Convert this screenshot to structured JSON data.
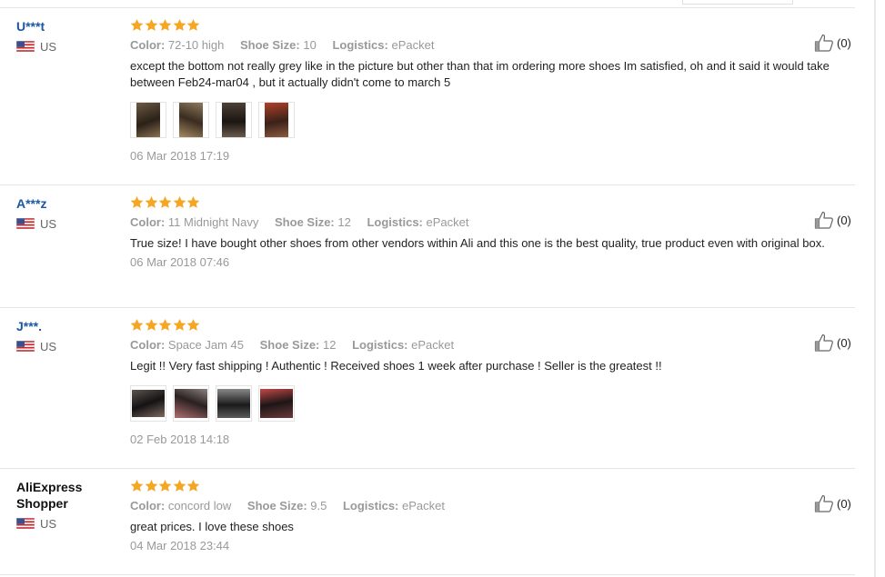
{
  "labels": {
    "color": "Color:",
    "shoe_size": "Shoe Size:",
    "logistics": "Logistics:"
  },
  "reviews": [
    {
      "user": "U***t",
      "country": "US",
      "rating": 5,
      "color": "72-10 high",
      "shoe_size": "10",
      "logistics": "ePacket",
      "text": "except the bottom not really grey like in the picture but other than that im ordering more shoes Im satisfied, oh and it said it would take between Feb24-mar04 , but it actually didn't come to march 5",
      "photo_count": 4,
      "date": "06 Mar 2018 17:19",
      "likes": "(0)"
    },
    {
      "user": "A***z",
      "country": "US",
      "rating": 5,
      "color": "11 Midnight Navy",
      "shoe_size": "12",
      "logistics": "ePacket",
      "text": "True size! I have bought other shoes from other vendors within Ali and this one is the best quality, true product even with original box.",
      "photo_count": 0,
      "date": "06 Mar 2018 07:46",
      "likes": "(0)"
    },
    {
      "user": "J***.",
      "country": "US",
      "rating": 5,
      "color": "Space Jam 45",
      "shoe_size": "12",
      "logistics": "ePacket",
      "text": "Legit !! Very fast shipping ! Authentic ! Received shoes 1 week after purchase ! Seller is the greatest !!",
      "photo_count": 4,
      "date": "02 Feb 2018 14:18",
      "likes": "(0)"
    },
    {
      "user": "AliExpress Shopper",
      "country": "US",
      "rating": 5,
      "color": "concord low",
      "shoe_size": "9.5",
      "logistics": "ePacket",
      "text": "great prices. I love these shoes",
      "photo_count": 0,
      "date": "04 Mar 2018 23:44",
      "likes": "(0)"
    }
  ],
  "colors": {
    "star": "#f5a623",
    "user_link": "#1a58a6",
    "muted": "#999999"
  },
  "icons": {
    "star": "star-icon",
    "like": "thumbs-up-icon",
    "flag": "us-flag-icon"
  }
}
